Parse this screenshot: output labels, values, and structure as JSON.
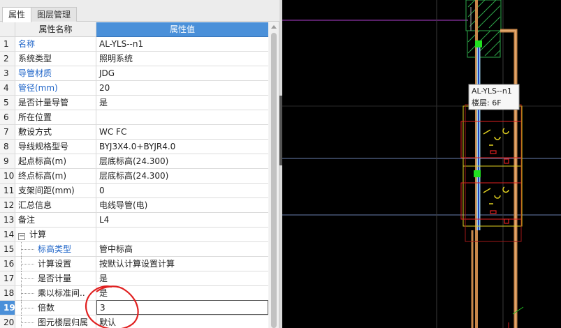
{
  "tabs": [
    {
      "label": "属性",
      "active": true
    },
    {
      "label": "图层管理",
      "active": false
    }
  ],
  "grid": {
    "header_name": "属性名称",
    "header_value": "属性值",
    "rows": [
      {
        "num": "1",
        "name": "名称",
        "value": "AL-YLS--n1"
      },
      {
        "num": "2",
        "name": "系统类型",
        "value": "照明系统"
      },
      {
        "num": "3",
        "name": "导管材质",
        "value": "JDG"
      },
      {
        "num": "4",
        "name": "管径(mm)",
        "value": "20"
      },
      {
        "num": "5",
        "name": "是否计量导管",
        "value": "是"
      },
      {
        "num": "6",
        "name": "所在位置",
        "value": ""
      },
      {
        "num": "7",
        "name": "敷设方式",
        "value": "WC FC"
      },
      {
        "num": "8",
        "name": "导线规格型号",
        "value": "BYJ3X4.0+BYJR4.0"
      },
      {
        "num": "9",
        "name": "起点标高(m)",
        "value": "层底标高(24.300)"
      },
      {
        "num": "10",
        "name": "终点标高(m)",
        "value": "层底标高(24.300)"
      },
      {
        "num": "11",
        "name": "支架间距(mm)",
        "value": "0"
      },
      {
        "num": "12",
        "name": "汇总信息",
        "value": "电线导管(电)"
      },
      {
        "num": "13",
        "name": "备注",
        "value": "L4"
      },
      {
        "num": "14",
        "name": "计算",
        "value": "",
        "expander": "−"
      },
      {
        "num": "15",
        "name": "标高类型",
        "value": "管中标高"
      },
      {
        "num": "16",
        "name": "计算设置",
        "value": "按默认计算设置计算"
      },
      {
        "num": "17",
        "name": "是否计量",
        "value": "是"
      },
      {
        "num": "18",
        "name": "乘以标准间..",
        "value": "是"
      },
      {
        "num": "19",
        "name": "倍数",
        "value": "3"
      },
      {
        "num": "20",
        "name": "图元楼层归属",
        "value": "默认"
      }
    ]
  },
  "canvas": {
    "tooltip_name": "AL-YLS--n1",
    "tooltip_floor": "楼层: 6F"
  },
  "colors": {
    "header_blue": "#4a90d9",
    "link_blue": "#1e64c8",
    "canvas_bg": "#000000",
    "pipe_tan": "#c8874a",
    "annotation_red": "#e02020"
  },
  "icons": [
    "collapse-icon",
    "scroll-up-icon"
  ]
}
